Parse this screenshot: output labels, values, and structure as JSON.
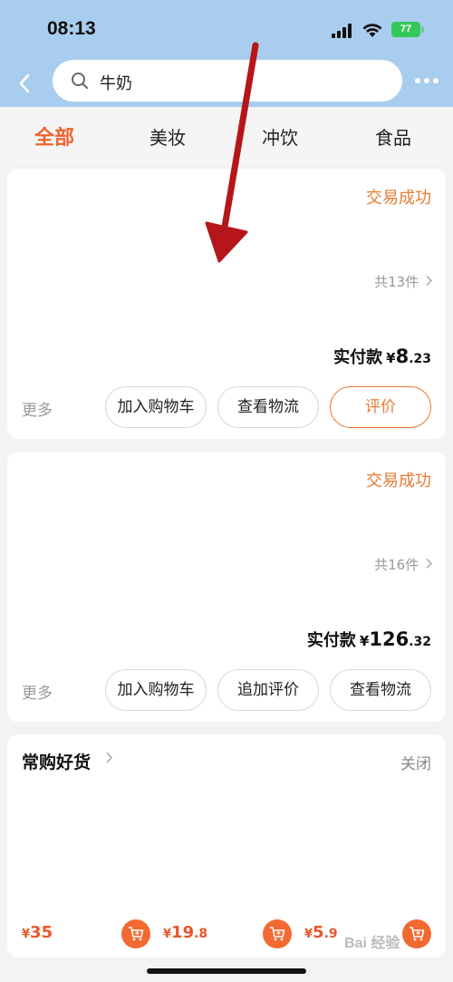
{
  "status_bar": {
    "time": "08:13",
    "battery": "77"
  },
  "search": {
    "query": "牛奶"
  },
  "tabs": [
    {
      "label": "全部"
    },
    {
      "label": "美妆"
    },
    {
      "label": "冲饮"
    },
    {
      "label": "食品"
    }
  ],
  "orders": [
    {
      "status": "交易成功",
      "count": "共13件",
      "paid_label": "实付款",
      "currency": "¥",
      "amount_int": "8",
      "amount_dec": ".23",
      "more": "更多",
      "buttons": [
        "加入购物车",
        "查看物流",
        "评价"
      ]
    },
    {
      "status": "交易成功",
      "count": "共16件",
      "paid_label": "实付款",
      "currency": "¥",
      "amount_int": "126",
      "amount_dec": ".32",
      "more": "更多",
      "buttons": [
        "加入购物车",
        "追加评价",
        "查看物流"
      ]
    }
  ],
  "frequent": {
    "title": "常购好货",
    "close": "关闭",
    "items": [
      {
        "currency": "¥",
        "int": "35",
        "dec": ""
      },
      {
        "currency": "¥",
        "int": "19",
        "dec": ".8"
      },
      {
        "currency": "¥",
        "int": "5",
        "dec": ".9"
      }
    ]
  },
  "watermark": "Bai 经验",
  "colors": {
    "accent": "#f0622c",
    "status": "#e97b33",
    "header": "#a9cdee",
    "arrow": "#b5161a"
  }
}
